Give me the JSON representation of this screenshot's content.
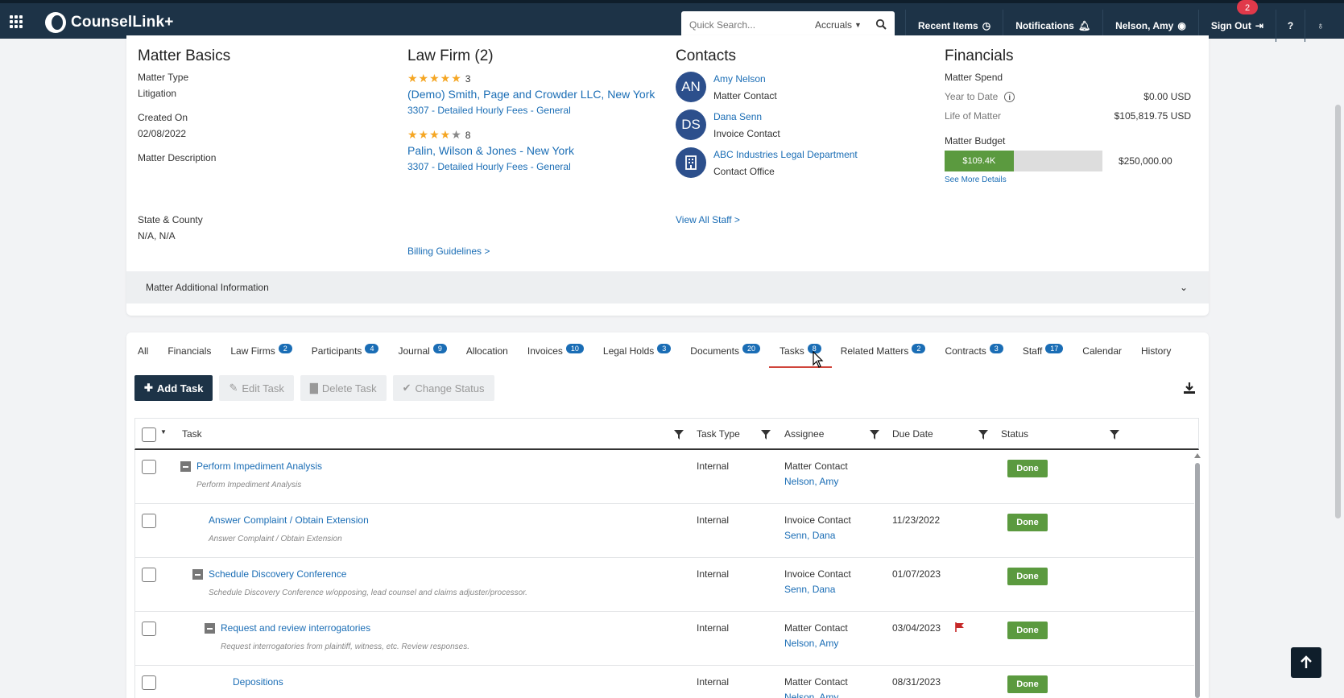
{
  "app": {
    "name": "CounselLink+",
    "search_placeholder": "Quick Search...",
    "search_scope": "Accruals",
    "nav": [
      "Recent Items",
      "Notifications",
      "Nelson, Amy",
      "Sign Out"
    ],
    "notification_count": "2"
  },
  "basics": {
    "title": "Matter Basics",
    "matter_type_label": "Matter Type",
    "matter_type": "Litigation",
    "created_label": "Created On",
    "created": "02/08/2022",
    "description_label": "Matter Description",
    "state_label": "State & County",
    "state": "N/A, N/A"
  },
  "law_firm": {
    "title": "Law Firm (2)",
    "firms": [
      {
        "rating": 4.5,
        "count": "3",
        "name": "(Demo) Smith, Page and Crowder LLC, New York",
        "fee": "3307 - Detailed Hourly Fees - General"
      },
      {
        "rating": 3.5,
        "count": "8",
        "name": "Palin, Wilson & Jones - New York",
        "fee": "3307 - Detailed Hourly Fees - General"
      }
    ],
    "billing_link": "Billing Guidelines >"
  },
  "contacts": {
    "title": "Contacts",
    "items": [
      {
        "initials": "AN",
        "name": "Amy Nelson",
        "role": "Matter Contact"
      },
      {
        "initials": "DS",
        "name": "Dana Senn",
        "role": "Invoice Contact"
      },
      {
        "initials": "",
        "name": "ABC Industries Legal Department",
        "role": "Contact Office"
      }
    ],
    "staff_link": "View All Staff >"
  },
  "financials": {
    "title": "Financials",
    "spend_label": "Matter Spend",
    "ytd_label": "Year to Date",
    "ytd": "$0.00 USD",
    "life_label": "Life of Matter",
    "life": "$105,819.75 USD",
    "budget_label": "Matter Budget",
    "budget_used": "$109.4K",
    "budget_fraction": 0.437,
    "budget_total": "$250,000.00",
    "see_more": "See More Details"
  },
  "additional_info": "Matter Additional Information",
  "tabs": [
    {
      "label": "All",
      "count": ""
    },
    {
      "label": "Financials",
      "count": ""
    },
    {
      "label": "Law Firms",
      "count": "2"
    },
    {
      "label": "Participants",
      "count": "4"
    },
    {
      "label": "Journal",
      "count": "9"
    },
    {
      "label": "Allocation",
      "count": ""
    },
    {
      "label": "Invoices",
      "count": "10"
    },
    {
      "label": "Legal Holds",
      "count": "3"
    },
    {
      "label": "Documents",
      "count": "20"
    },
    {
      "label": "Tasks",
      "count": "8"
    },
    {
      "label": "Related Matters",
      "count": "2"
    },
    {
      "label": "Contracts",
      "count": "3"
    },
    {
      "label": "Staff",
      "count": "17"
    },
    {
      "label": "Calendar",
      "count": ""
    },
    {
      "label": "History",
      "count": ""
    }
  ],
  "toolbar": {
    "add": "Add Task",
    "edit": "Edit Task",
    "delete": "Delete Task",
    "status": "Change Status"
  },
  "table": {
    "headers": {
      "task": "Task",
      "type": "Task Type",
      "assignee": "Assignee",
      "due": "Due Date",
      "status": "Status"
    },
    "rows": [
      {
        "title": "Perform Impediment Analysis",
        "desc": "Perform Impediment Analysis",
        "type": "Internal",
        "role": "Matter Contact",
        "name": "Nelson, Amy",
        "due": "",
        "status": "Done"
      },
      {
        "title": "Answer Complaint / Obtain Extension",
        "desc": "Answer Complaint / Obtain Extension",
        "type": "Internal",
        "role": "Invoice Contact",
        "name": "Senn, Dana",
        "due": "11/23/2022",
        "status": "Done"
      },
      {
        "title": "Schedule Discovery Conference",
        "desc": "Schedule Discovery Conference w/opposing, lead counsel and claims adjuster/processor.",
        "type": "Internal",
        "role": "Invoice Contact",
        "name": "Senn, Dana",
        "due": "01/07/2023",
        "status": "Done"
      },
      {
        "title": "Request and review interrogatories",
        "desc": "Request interrogatories from plaintiff, witness, etc. Review responses.",
        "type": "Internal",
        "role": "Matter Contact",
        "name": "Nelson, Amy",
        "due": "03/04/2023",
        "status": "Done"
      },
      {
        "title": "Depositions",
        "desc": "",
        "type": "Internal",
        "role": "Matter Contact",
        "name": "Nelson, Amy",
        "due": "08/31/2023",
        "status": "Done"
      }
    ]
  }
}
